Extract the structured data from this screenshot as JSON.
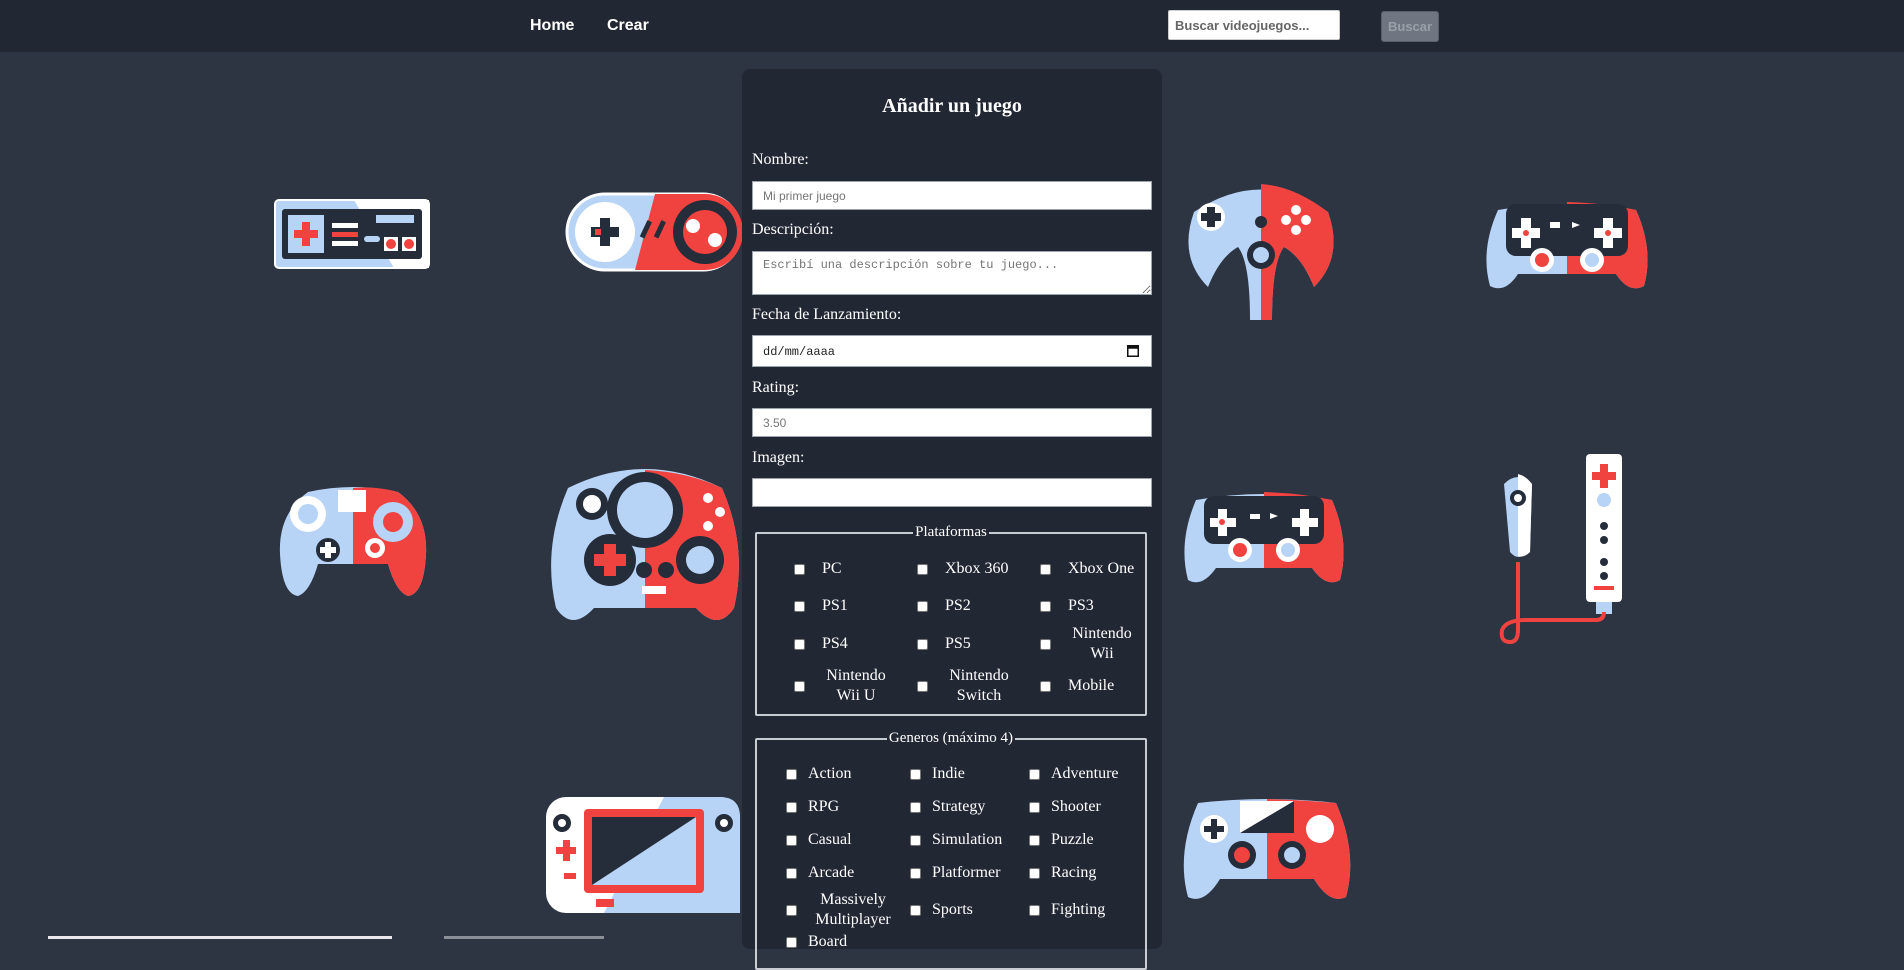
{
  "nav": {
    "home_label": "Home",
    "create_label": "Crear",
    "search_placeholder": "Buscar videojuegos...",
    "search_button": "Buscar"
  },
  "form": {
    "title": "Añadir un juego",
    "name_label": "Nombre:",
    "name_placeholder": "Mi primer juego",
    "description_label": "Descripción:",
    "description_placeholder": "Escribí una descripción sobre tu juego...",
    "release_label": "Fecha de Lanzamiento:",
    "release_placeholder": "dd/mm/aaaa",
    "rating_label": "Rating:",
    "rating_placeholder": "3.50",
    "image_label": "Imagen:",
    "image_value": ""
  },
  "platforms": {
    "legend": "Plataformas",
    "items": [
      "PC",
      "Xbox 360",
      "Xbox One",
      "PS1",
      "PS2",
      "PS3",
      "PS4",
      "PS5",
      "Nintendo Wii",
      "Nintendo Wii U",
      "Nintendo Switch",
      "Mobile"
    ]
  },
  "genres": {
    "legend": "Generos (máximo 4)",
    "items": [
      "Action",
      "Indie",
      "Adventure",
      "RPG",
      "Strategy",
      "Shooter",
      "Casual",
      "Simulation",
      "Puzzle",
      "Arcade",
      "Platformer",
      "Racing",
      "Massively Multiplayer",
      "Sports",
      "Fighting",
      "Board"
    ]
  },
  "colors": {
    "background": "#2d3442",
    "navbar": "#222833",
    "panel": "#212733",
    "accent_red": "#f0433f",
    "accent_blue": "#b7d3f5",
    "dark": "#252c3a"
  }
}
